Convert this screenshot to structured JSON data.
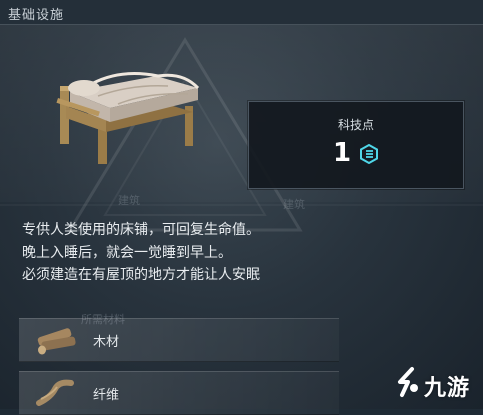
{
  "header": {
    "title": "基础设施"
  },
  "tech": {
    "label": "科技点",
    "value": "1",
    "icon": "tech-point-icon"
  },
  "faded": {
    "left": "建筑",
    "right": "建筑",
    "materials": "所需材料"
  },
  "description": {
    "line1": "专供人类使用的床铺，可回复生命值。",
    "line2": "晚上入睡后，就会一觉睡到早上。",
    "line3": "必须建造在有屋顶的地方才能让人安眠"
  },
  "materials": [
    {
      "label": "木材",
      "icon": "wood-icon"
    },
    {
      "label": "纤维",
      "icon": "fiber-icon"
    }
  ],
  "watermark": {
    "text": "九游",
    "icon": "jiuyou-logo-icon"
  },
  "colors": {
    "accent": "#4fd6e8",
    "background": "#28333d",
    "text": "#e8ecef"
  }
}
